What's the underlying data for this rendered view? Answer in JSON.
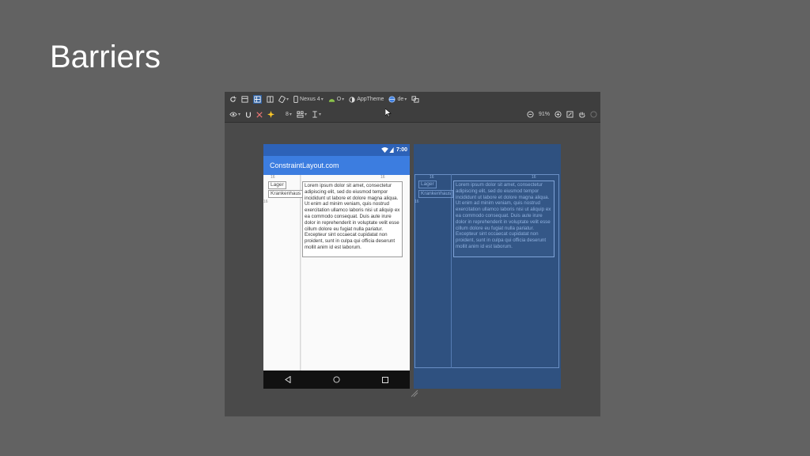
{
  "slide": {
    "title": "Barriers"
  },
  "toolbar": {
    "device": "Nexus 4",
    "api": "O",
    "theme": "AppTheme",
    "locale": "de",
    "margin": "8",
    "zoom": "91%"
  },
  "phone": {
    "time": "7:00",
    "app_title": "ConstraintLayout.com",
    "label_lager": "Lager",
    "label_krankenhaus": "Krankenhaus",
    "lorem": "Lorem ipsum dolor sit amet, consectetur adipiscing elit, sed do eiusmod tempor incididunt ut labore et dolore magna aliqua. Ut enim ad minim veniam, quis nostrud exercitation ullamco laboris nisi ut aliquip ex ea commodo consequat. Duis aute irure dolor in reprehenderit in voluptate velit esse cillum dolore eu fugiat nulla pariatur. Excepteur sint occaecat cupidatat non proident, sunt in culpa qui officia deserunt mollit anim id est laborum.",
    "dim_16": "16"
  },
  "colors": {
    "status_bar": "#2d62b8",
    "app_bar": "#3c7de0",
    "blueprint": "#2f5180"
  }
}
